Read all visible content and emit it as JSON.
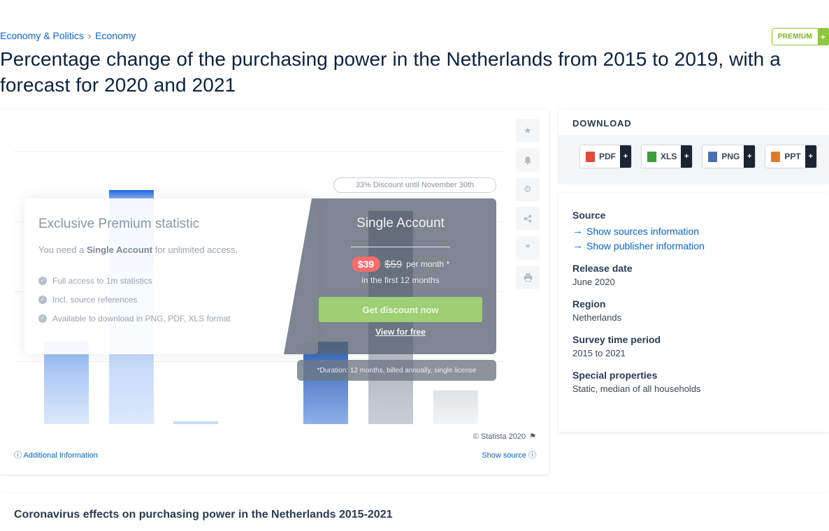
{
  "breadcrumb": {
    "items": [
      "Economy & Politics",
      "Economy"
    ],
    "separator": "›"
  },
  "premium_badge": {
    "label": "PREMIUM",
    "plus": "+"
  },
  "page_title": "Percentage change of the purchasing power in the Netherlands from 2015 to 2019, with a forecast for 2020 and 2021",
  "paywall": {
    "title": "Exclusive Premium statistic",
    "subtitle_prefix": "You need a ",
    "subtitle_bold": "Single Account",
    "subtitle_suffix": " for unlimited access.",
    "features": [
      "Full access to 1m statistics",
      "Incl. source references",
      "Available to download in PNG, PDF, XLS format"
    ],
    "discount_pill": "33% Discount until November 30th",
    "account_title": "Single Account",
    "price_new": "$39",
    "price_old": "$59",
    "price_period": "per month *",
    "price_note": "in the first 12 months",
    "cta": "Get discount now",
    "view_free": "View for free",
    "duration": "*Duration: 12 months, billed annually, single license"
  },
  "chart_footer": {
    "copyright": "© Statista 2020",
    "additional_info": "Additional Information",
    "show_source": "Show source"
  },
  "side_icons": [
    "star-icon",
    "bell-icon",
    "gear-icon",
    "share-icon",
    "quote-icon",
    "print-icon"
  ],
  "download": {
    "header": "DOWNLOAD",
    "formats": [
      {
        "label": "PDF",
        "color": "#e24b3b"
      },
      {
        "label": "XLS",
        "color": "#3f9a3f"
      },
      {
        "label": "PNG",
        "color": "#4a6fb5"
      },
      {
        "label": "PPT",
        "color": "#e07a2c"
      }
    ],
    "plus": "+"
  },
  "meta": {
    "source_label": "Source",
    "show_sources": "Show sources information",
    "show_publisher": "Show publisher information",
    "release_label": "Release date",
    "release_value": "June 2020",
    "region_label": "Region",
    "region_value": "Netherlands",
    "survey_label": "Survey time period",
    "survey_value": "2015 to 2021",
    "special_label": "Special properties",
    "special_value": "Static, median of all households"
  },
  "bottom_panel": {
    "title": "Coronavirus effects on purchasing power in the Netherlands 2015-2021"
  },
  "colors": {
    "accent": "#0666e5",
    "bar": "#1f6ae3",
    "forecast_bar": "#6b7584",
    "premium": "#8dc63f"
  }
}
